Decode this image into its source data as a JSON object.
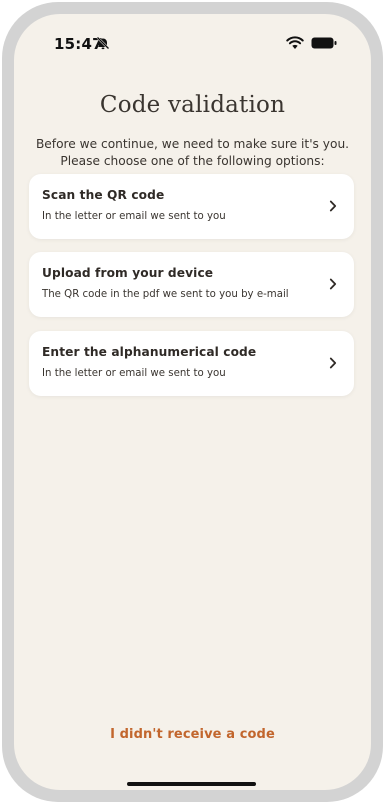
{
  "status_bar": {
    "time": "15:47",
    "icons": [
      "bell-off-icon",
      "wifi-icon",
      "battery-icon"
    ]
  },
  "page": {
    "title": "Code validation",
    "intro": "Before we continue, we need to make sure it's you. Please choose one of the following options:"
  },
  "options": [
    {
      "title": "Scan the QR code",
      "subtitle": "In the letter or email we sent to you"
    },
    {
      "title": "Upload from your device",
      "subtitle": "The QR code in the pdf we sent to you by e-mail"
    },
    {
      "title": "Enter the alphanumerical code",
      "subtitle": "In the letter or email we sent to you"
    }
  ],
  "footer": {
    "resend_label": "I didn't receive a code"
  },
  "colors": {
    "background": "#f5f1ea",
    "card": "#ffffff",
    "accent": "#c2662d",
    "text": "#3a3530",
    "frame": "#d3d3d3"
  }
}
